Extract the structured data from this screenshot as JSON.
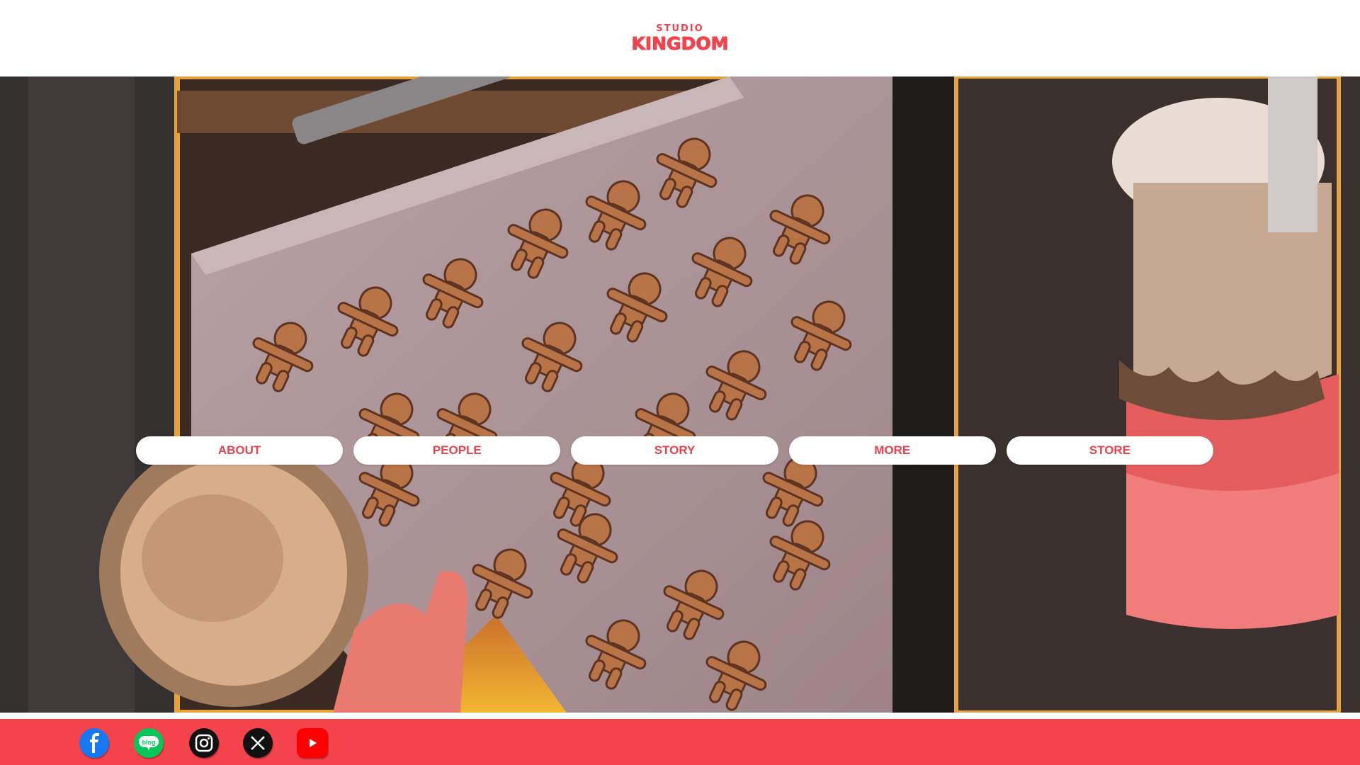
{
  "brand": {
    "logo_top": "STUDIO",
    "logo_main": "KINGDOM",
    "accent": "#f5434b"
  },
  "nav": {
    "items": [
      {
        "label": "ABOUT"
      },
      {
        "label": "PEOPLE"
      },
      {
        "label": "STORY"
      },
      {
        "label": "MORE"
      },
      {
        "label": "STORE"
      }
    ]
  },
  "hero": {
    "image": "gingerbread-cookies-baking-tray-illustration"
  },
  "footer": {
    "social": [
      {
        "icon": "facebook-icon",
        "color": "#1877f2"
      },
      {
        "icon": "blog-icon",
        "color": "#03c75a"
      },
      {
        "icon": "instagram-icon",
        "color": "#111111"
      },
      {
        "icon": "x-icon",
        "color": "#111111"
      },
      {
        "icon": "youtube-icon",
        "color": "#ff0000"
      }
    ]
  }
}
